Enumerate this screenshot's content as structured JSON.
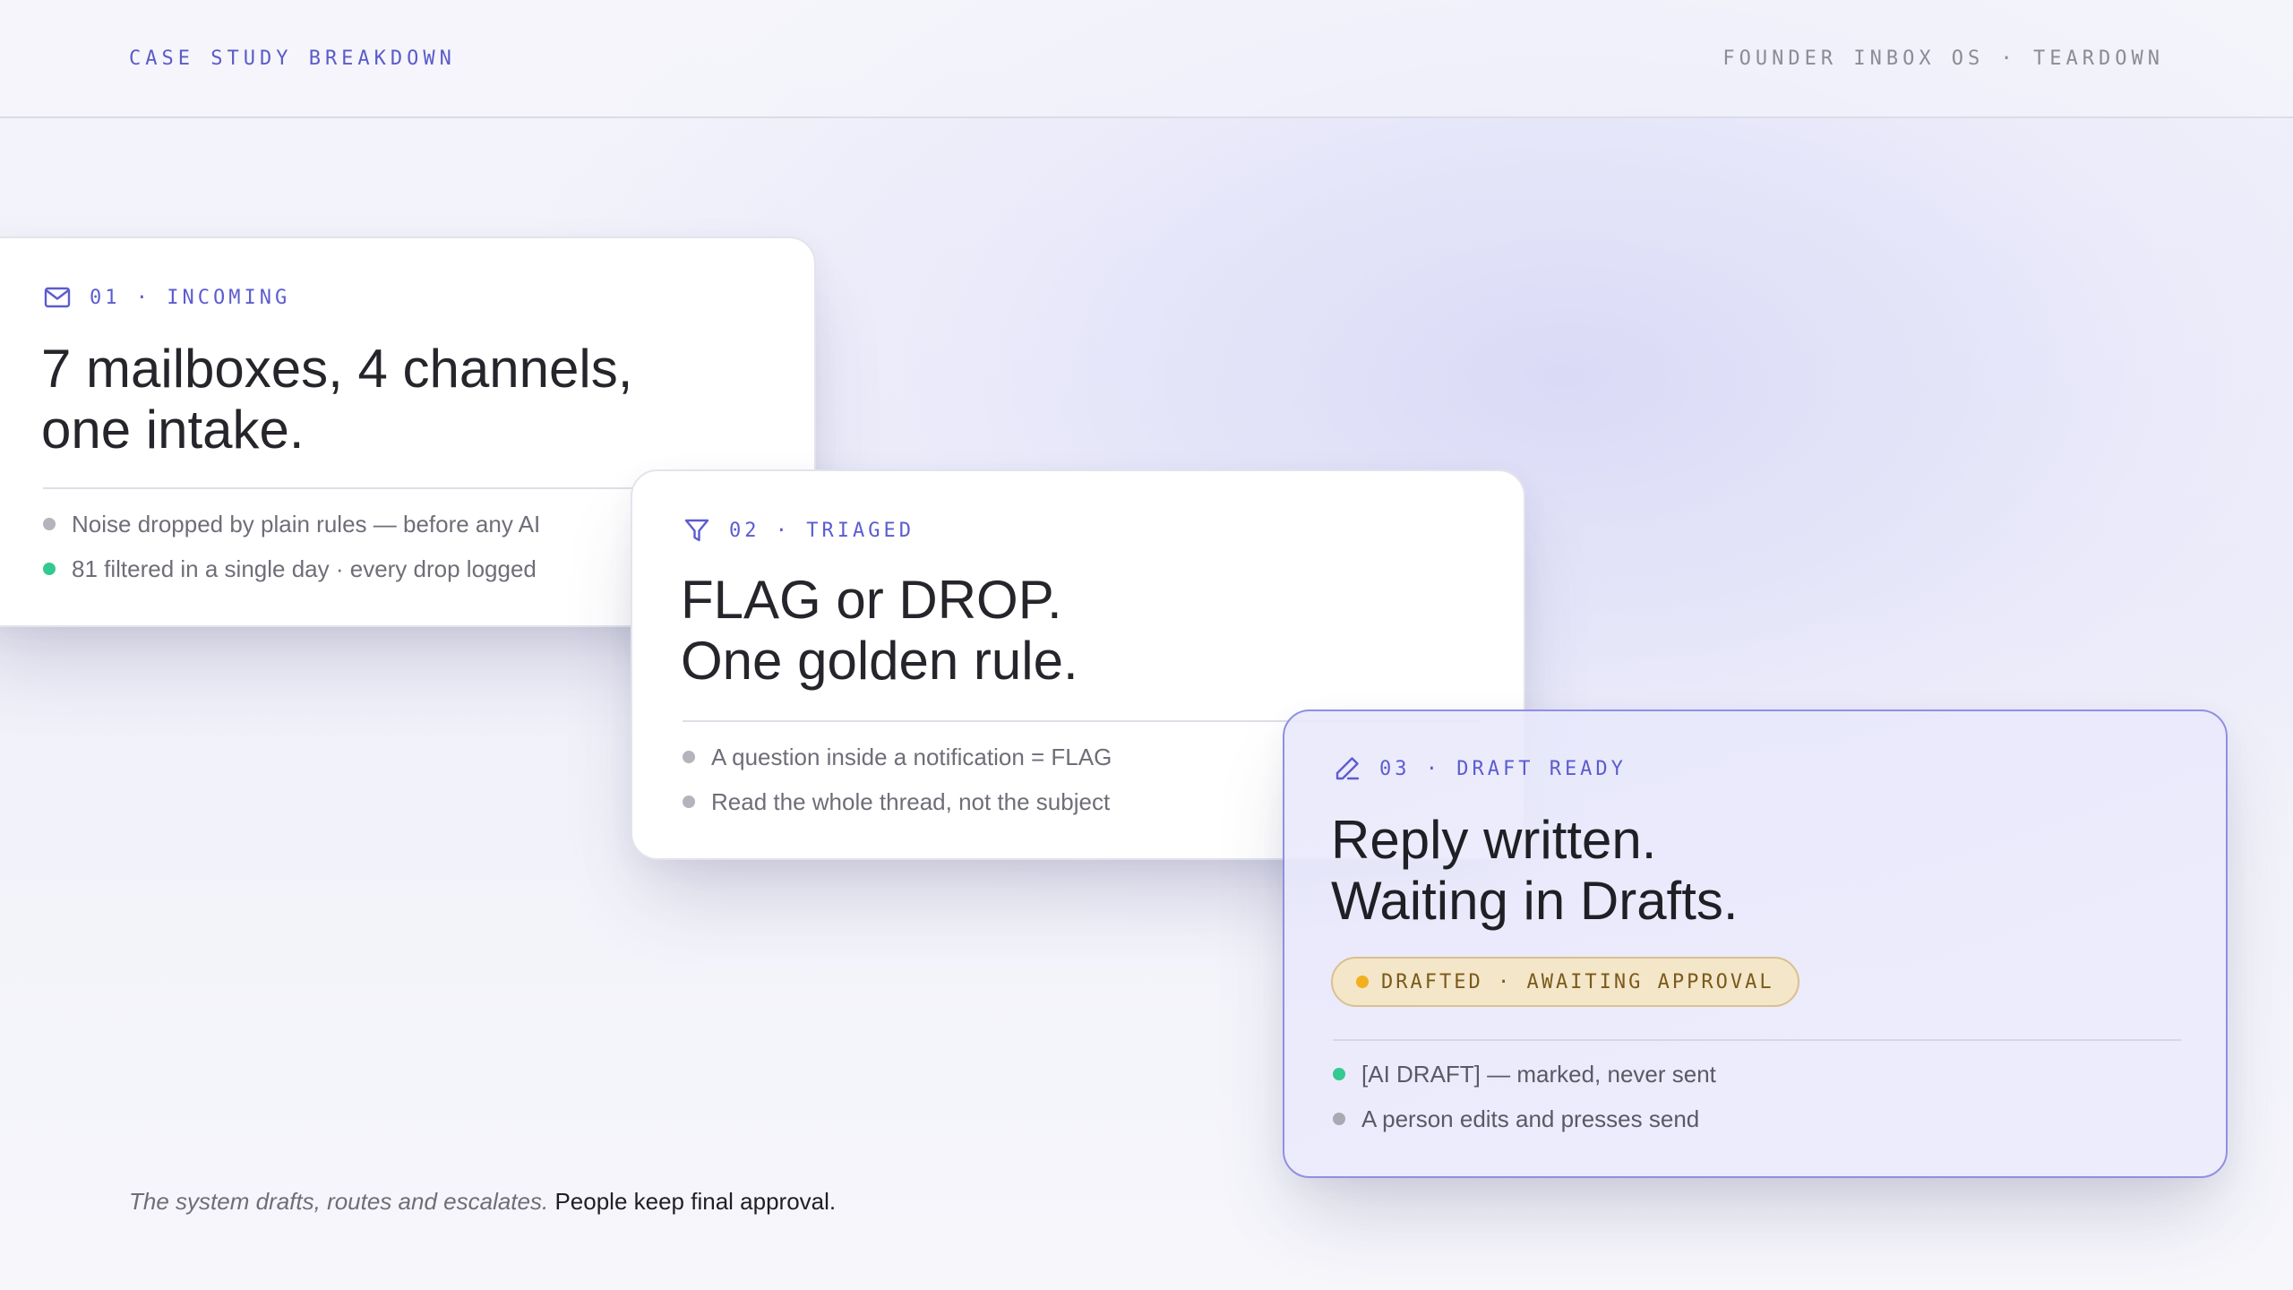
{
  "header": {
    "left_label": "CASE STUDY BREAKDOWN",
    "right_label": "FOUNDER INBOX OS · TEARDOWN"
  },
  "cards": [
    {
      "step": "01 · INCOMING",
      "icon": "mail-icon",
      "title_lines": [
        "7 mailboxes, 4 channels,",
        "one intake."
      ],
      "bullets": [
        {
          "text": "Noise dropped by plain rules — before any AI",
          "dot_color": "#b4b4bc"
        },
        {
          "text": "81 filtered in a single day · every drop logged",
          "dot_color": "#33c98f"
        }
      ]
    },
    {
      "step": "02 · TRIAGED",
      "icon": "filter-icon",
      "title_lines": [
        "FLAG or DROP.",
        "One golden rule."
      ],
      "bullets": [
        {
          "text": "A question inside a notification = FLAG",
          "dot_color": "#b4b4bc"
        },
        {
          "text": "Read the whole thread, not the subject",
          "dot_color": "#b4b4bc"
        }
      ]
    },
    {
      "step": "03 · DRAFT READY",
      "icon": "pencil-icon",
      "title_lines": [
        "Reply written.",
        "Waiting in Drafts."
      ],
      "status": {
        "text": "DRAFTED · AWAITING APPROVAL",
        "dot_color": "#f2b01e"
      },
      "bullets": [
        {
          "text": "[AI DRAFT] — marked, never sent",
          "dot_color": "#33c98f"
        },
        {
          "text": "A person edits and presses send",
          "dot_color": "#a9a9b4"
        }
      ]
    }
  ],
  "footer": {
    "muted": "The system drafts, routes and escalates.",
    "strong": "People keep final approval."
  },
  "colors": {
    "accent": "#5c5cd0",
    "success": "#33c98f",
    "warning": "#f2b01e",
    "neutral_dot": "#b4b4bc"
  }
}
